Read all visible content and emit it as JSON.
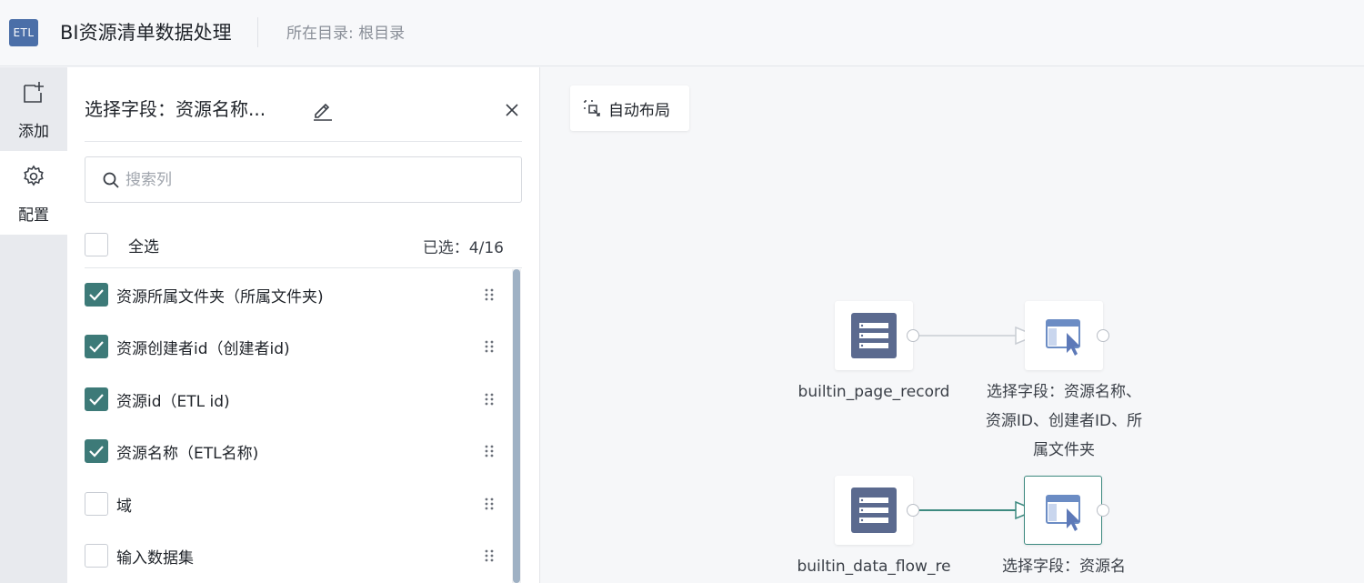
{
  "header": {
    "logo_text": "ETL",
    "title": "BI资源清单数据处理",
    "directory": "所在目录: 根目录"
  },
  "rail": {
    "items": [
      {
        "label": "添加",
        "icon": "add-node-icon"
      },
      {
        "label": "配置",
        "icon": "gear-icon"
      }
    ]
  },
  "panel": {
    "title": "选择字段：资源名称...",
    "search_placeholder": "搜索列",
    "select_all_label": "全选",
    "selected_count": "已选：4/16",
    "fields": [
      {
        "label": "资源所属文件夹（所属文件夹)",
        "checked": true
      },
      {
        "label": "资源创建者id（创建者id)",
        "checked": true
      },
      {
        "label": "资源id（ETL id)",
        "checked": true
      },
      {
        "label": "资源名称（ETL名称)",
        "checked": true
      },
      {
        "label": "域",
        "checked": false
      },
      {
        "label": "输入数据集",
        "checked": false
      }
    ]
  },
  "canvas": {
    "auto_layout_label": "自动布局",
    "nodes": [
      {
        "label": "builtin_page_record",
        "type": "dataset-icon"
      },
      {
        "label": "选择字段：资源名称、资源ID、创建者ID、所属文件夹",
        "type": "select-fields-icon"
      },
      {
        "label": "builtin_data_flow_re",
        "type": "dataset-icon"
      },
      {
        "label": "选择字段：资源名",
        "type": "select-fields-icon"
      }
    ]
  },
  "colors": {
    "accent": "#3d7a78",
    "logo_bg": "#4b6fa8",
    "dataset_icon": "#5b6a8f",
    "edge_active": "#3d8a80"
  }
}
